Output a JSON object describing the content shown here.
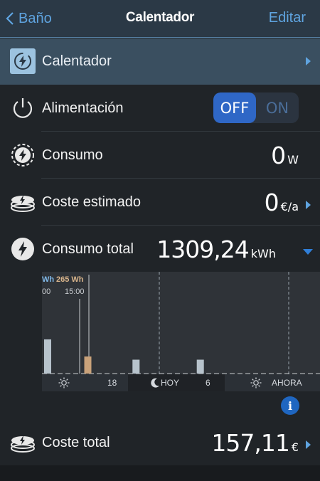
{
  "nav": {
    "back_label": "Baño",
    "title": "Calentador",
    "edit_label": "Editar"
  },
  "device": {
    "label": "Calentador"
  },
  "power": {
    "label": "Alimentación",
    "off_label": "OFF",
    "on_label": "ON",
    "state": "OFF"
  },
  "consumo": {
    "label": "Consumo",
    "value": "0",
    "unit": "W"
  },
  "coste_estimado": {
    "label": "Coste estimado",
    "value": "0",
    "unit": "€/a"
  },
  "consumo_total": {
    "label": "Consumo total",
    "value": "1309,24",
    "unit": "kWh"
  },
  "chart_data": {
    "type": "bar",
    "highlight": {
      "value_label": "265 Wh",
      "time_label": "15:00"
    },
    "left_cut_labels": {
      "value": "Wh",
      "time": "00"
    },
    "values": [
      0.32,
      0,
      0,
      0,
      0,
      0.16,
      0,
      0,
      0,
      0,
      0,
      0.13,
      0,
      0,
      0,
      0,
      0,
      0,
      0,
      0.13,
      0,
      0,
      0,
      0,
      0,
      0,
      0,
      0
    ],
    "highlight_index": 5,
    "timeline": {
      "left_num": "18",
      "hoy": "HOY",
      "right_num": "6",
      "ahora": "AHORA"
    }
  },
  "coste_total": {
    "label": "Coste total",
    "value": "157,11",
    "unit": "€"
  },
  "colors": {
    "accent": "#5fa4e0",
    "toggle_active": "#2f67c6",
    "bar": "#b7c3cc",
    "bar_highlight": "#c9a27a"
  }
}
